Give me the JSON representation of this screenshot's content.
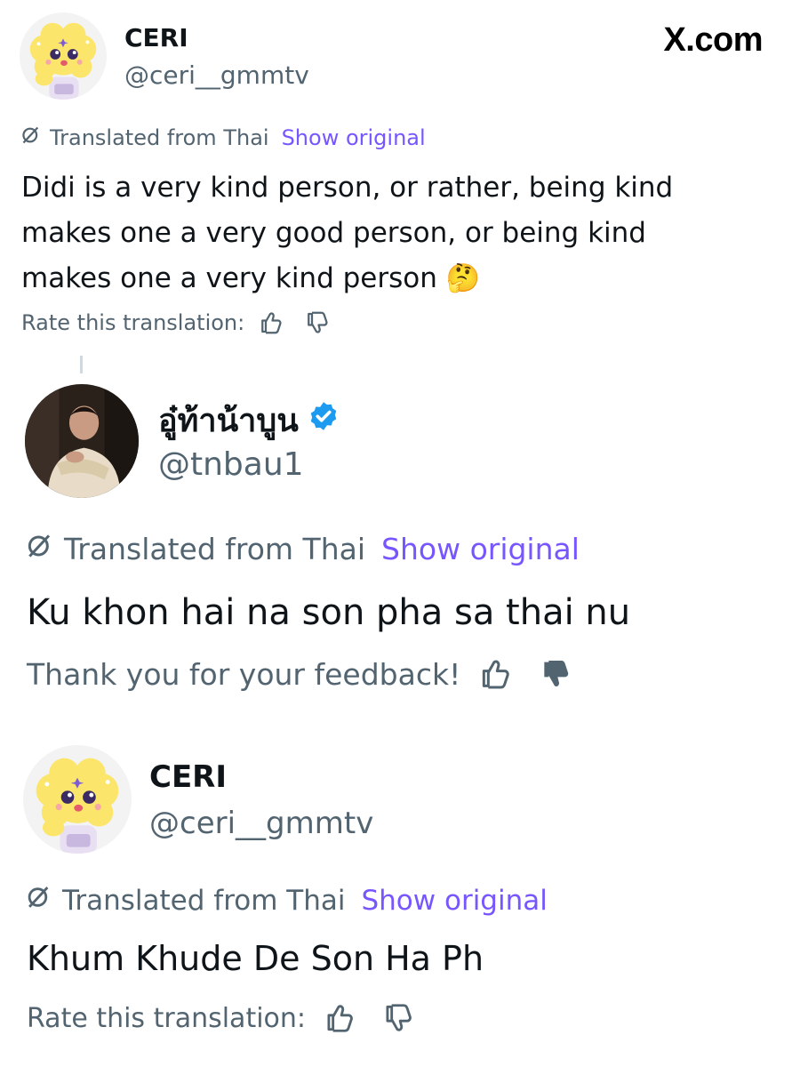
{
  "site": {
    "label": "X.com"
  },
  "posts": [
    {
      "name": "CERI",
      "handle": "@ceri__gmmtv",
      "translated_label": "Translated from Thai",
      "show_original": "Show original",
      "text": "Didi is a very kind person, or rather, being kind makes one a very good person, or being kind makes one a very kind person 🤔",
      "rating_label": "Rate this translation:",
      "avatar_icon": "mascot-avatar-icon"
    },
    {
      "name": "อู๋ท้าน้าบูน",
      "handle": "@tnbau1",
      "verified": true,
      "translated_label": "Translated from Thai",
      "show_original": "Show original",
      "text": "Ku khon hai na son pha sa thai nu",
      "rating_label": "Thank you for your feedback!",
      "thumbs_down_selected": true,
      "avatar_icon": "profile-photo"
    },
    {
      "name": "CERI",
      "handle": "@ceri__gmmtv",
      "translated_label": "Translated from Thai",
      "show_original": "Show original",
      "text": "Khum Khude De Son Ha Ph",
      "rating_label": "Rate this translation:",
      "avatar_icon": "mascot-avatar-icon"
    }
  ],
  "colors": {
    "text": "#0f1419",
    "secondary": "#536471",
    "link": "#7856ff",
    "verified": "#1d9bf0"
  }
}
